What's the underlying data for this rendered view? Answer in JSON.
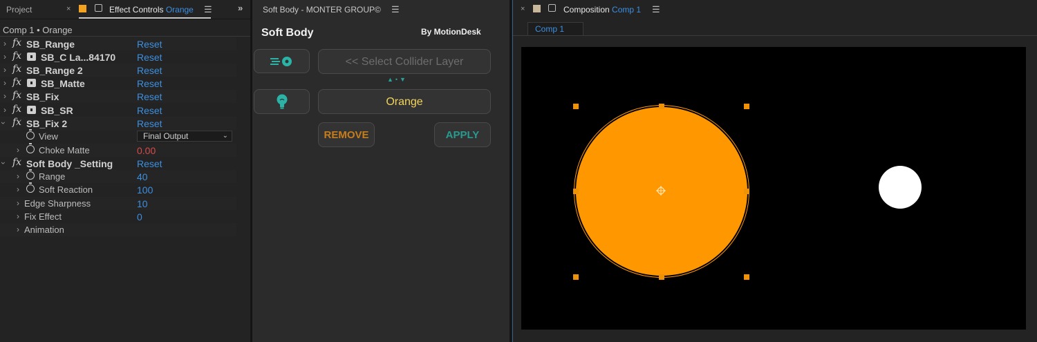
{
  "colors": {
    "accent_blue": "#3d8fe0",
    "orange_layer": "#ff9800",
    "label_swatch_orange": "#f4a321",
    "remove_text": "#c77d1c",
    "apply_text": "#2a9a90",
    "teal_icon": "#2ab3a6",
    "red_value": "#d84a4a"
  },
  "effect_controls_panel": {
    "project_tab": "Project",
    "close_symbol": "×",
    "effect_controls_tab": "Effect Controls",
    "effect_controls_layer": "Orange",
    "menu_icon": "hamburger-icon",
    "expand_icon": "double-chevron-right-icon",
    "header": "Comp 1 • Orange",
    "reset_label": "Reset",
    "effects": [
      {
        "name": "SB_Range",
        "has_lock": false
      },
      {
        "name": "SB_C La...84170",
        "has_lock": true
      },
      {
        "name": "SB_Range 2",
        "has_lock": false
      },
      {
        "name": "SB_Matte",
        "has_lock": true
      },
      {
        "name": "SB_Fix",
        "has_lock": false
      },
      {
        "name": "SB_SR",
        "has_lock": true
      },
      {
        "name": "SB_Fix 2",
        "has_lock": false,
        "expanded": true
      }
    ],
    "fix2_params": [
      {
        "name": "View",
        "value": "Final Output",
        "type": "dropdown"
      },
      {
        "name": "Choke Matte",
        "value": "0.00",
        "type": "number"
      }
    ],
    "setting_effect": {
      "name": "Soft Body _Setting",
      "expanded": true
    },
    "setting_params": [
      {
        "name": "Range",
        "value": "40",
        "stopwatch": true
      },
      {
        "name": "Soft Reaction",
        "value": "100",
        "stopwatch": true
      },
      {
        "name": "Edge Sharpness",
        "value": "10",
        "stopwatch": false
      },
      {
        "name": "Fix Effect",
        "value": "0",
        "stopwatch": false
      },
      {
        "name": "Animation",
        "value": "",
        "stopwatch": false
      }
    ]
  },
  "soft_body_panel": {
    "title": "Soft Body - MONTER GROUP©",
    "heading": "Soft Body",
    "by_label": "By MotionDesk",
    "collider_icon": "collider-arrow-icon",
    "select_collider_label": "<< Select Collider Layer",
    "swap_icon": "swap-arrows-icon",
    "layer_icon": "lightbulb-icon",
    "target_layer_label": "Orange",
    "remove_label": "REMOVE",
    "apply_label": "APPLY"
  },
  "composition_panel": {
    "tab_label": "Composition",
    "comp_name": "Comp 1",
    "sub_tab": "Comp 1",
    "swatch_color": "#c9b79c"
  }
}
